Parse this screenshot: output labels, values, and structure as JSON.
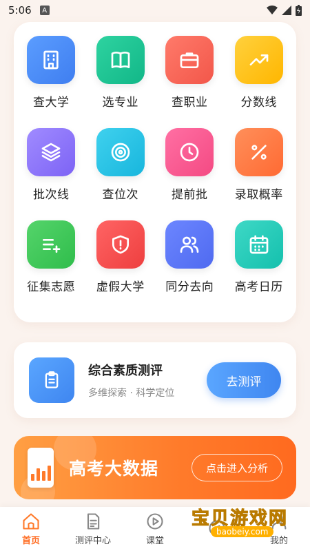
{
  "status_bar": {
    "time": "5:06",
    "notif_icon": "a-letter-icon"
  },
  "grid": [
    {
      "label": "查大学",
      "icon": "building-icon",
      "color": [
        "#5b9dff",
        "#3f7ef0"
      ]
    },
    {
      "label": "选专业",
      "icon": "book-icon",
      "color": [
        "#2ed3a0",
        "#12b788"
      ]
    },
    {
      "label": "查职业",
      "icon": "briefcase-icon",
      "color": [
        "#ff7a6a",
        "#f2574a"
      ]
    },
    {
      "label": "分数线",
      "icon": "trend-up-icon",
      "color": [
        "#ffd13d",
        "#ffb600"
      ]
    },
    {
      "label": "批次线",
      "icon": "layers-icon",
      "color": [
        "#a08bff",
        "#7d63f5"
      ]
    },
    {
      "label": "查位次",
      "icon": "target-icon",
      "color": [
        "#3fd1ee",
        "#18b6dd"
      ]
    },
    {
      "label": "提前批",
      "icon": "clock-icon",
      "color": [
        "#ff6fa3",
        "#f44a83"
      ]
    },
    {
      "label": "录取概率",
      "icon": "percent-icon",
      "color": [
        "#ff8f5a",
        "#ff6a33"
      ]
    },
    {
      "label": "征集志愿",
      "icon": "list-add-icon",
      "color": [
        "#55d46b",
        "#2fbd4b"
      ]
    },
    {
      "label": "虚假大学",
      "icon": "shield-alert-icon",
      "color": [
        "#ff6464",
        "#ee3f3f"
      ]
    },
    {
      "label": "同分去向",
      "icon": "users-icon",
      "color": [
        "#6c86ff",
        "#4f6af0"
      ]
    },
    {
      "label": "高考日历",
      "icon": "calendar-icon",
      "color": [
        "#3ed8c6",
        "#14c0ad"
      ]
    }
  ],
  "eval_card": {
    "icon": "clipboard-icon",
    "title": "综合素质测评",
    "subtitle": "多维探索 · 科学定位",
    "button": "去测评"
  },
  "banner": {
    "icon": "bar-chart-icon",
    "title": "高考大数据",
    "button": "点击进入分析"
  },
  "bottom_nav": [
    {
      "label": "首页",
      "icon": "home-icon",
      "active": true
    },
    {
      "label": "测评中心",
      "icon": "document-icon",
      "active": false
    },
    {
      "label": "课堂",
      "icon": "play-circle-icon",
      "active": false
    },
    {
      "label": "",
      "icon": "compass-icon",
      "active": false
    },
    {
      "label": "我的",
      "icon": "user-icon",
      "active": false
    }
  ],
  "watermark": {
    "text": "宝贝游戏网",
    "url": "baobeiy.com"
  },
  "colors": {
    "accent": "#ff7a2a",
    "background": "#fbf3ee"
  }
}
